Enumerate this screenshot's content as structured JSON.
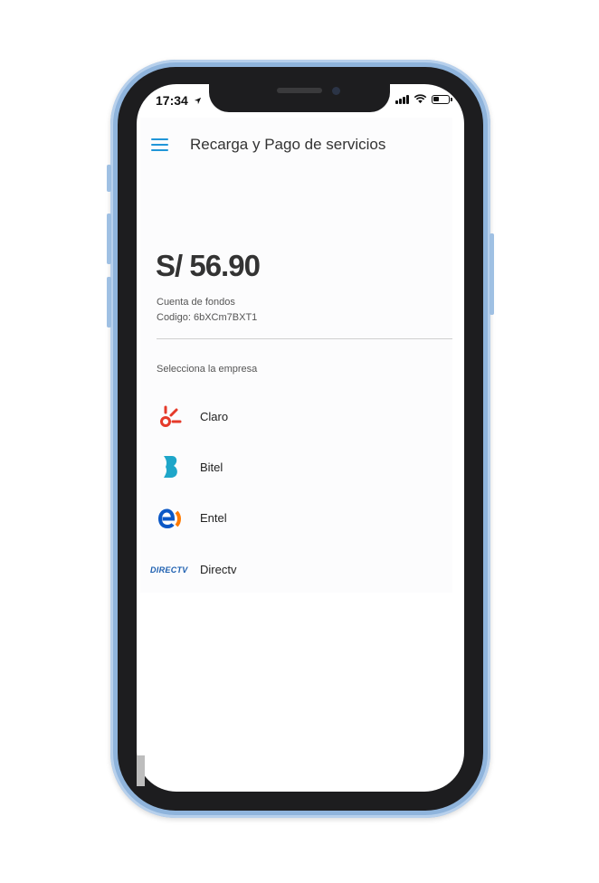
{
  "status_bar": {
    "time": "17:34"
  },
  "header": {
    "title": "Recarga y Pago de servicios",
    "menu_icon": "hamburger-menu-icon"
  },
  "account": {
    "balance": "S/ 56.90",
    "name": "Cuenta de fondos",
    "code": "Codigo: 6bXCm7BXT1"
  },
  "companies_section": {
    "label": "Selecciona la empresa",
    "items": [
      {
        "name": "Claro",
        "icon": "claro-logo-icon"
      },
      {
        "name": "Bitel",
        "icon": "bitel-logo-icon"
      },
      {
        "name": "Entel",
        "icon": "entel-logo-icon"
      },
      {
        "name": "Directv",
        "icon": "directv-logo-icon",
        "logo_text": "DIRECTV"
      }
    ]
  },
  "colors": {
    "accent": "#2196d8",
    "claro": "#e53a2a",
    "bitel": "#1ea6c9",
    "entel_blue": "#0a57c6",
    "entel_orange": "#ff7a00",
    "directv": "#1d5fb0",
    "device_frame": "#8fb4dc"
  }
}
